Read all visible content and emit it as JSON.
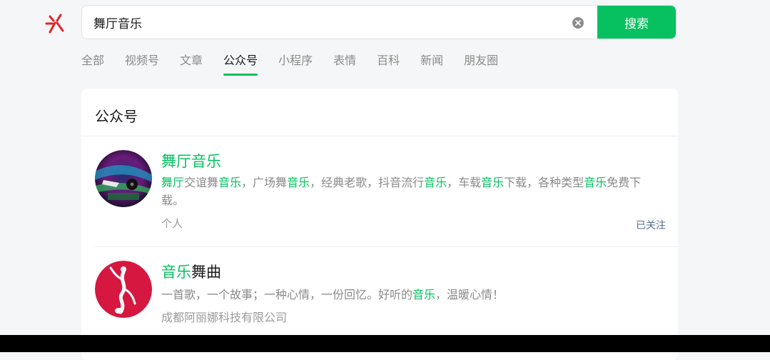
{
  "search": {
    "query": "舞厅音乐",
    "button_label": "搜索"
  },
  "tabs": [
    {
      "label": "全部"
    },
    {
      "label": "视频号"
    },
    {
      "label": "文章"
    },
    {
      "label": "公众号"
    },
    {
      "label": "小程序"
    },
    {
      "label": "表情"
    },
    {
      "label": "百科"
    },
    {
      "label": "新闻"
    },
    {
      "label": "朋友圈"
    }
  ],
  "active_tab": "公众号",
  "section_title": "公众号",
  "accounts": [
    {
      "name": "舞厅音乐",
      "desc_parts": [
        {
          "text": "舞厅",
          "hl": true
        },
        {
          "text": "交谊舞",
          "hl": false
        },
        {
          "text": "音乐",
          "hl": true
        },
        {
          "text": "，广场舞",
          "hl": false
        },
        {
          "text": "音乐",
          "hl": true
        },
        {
          "text": "，经典老歌，抖音流行",
          "hl": false
        },
        {
          "text": "音乐",
          "hl": true
        },
        {
          "text": "，车载",
          "hl": false
        },
        {
          "text": "音乐",
          "hl": true
        },
        {
          "text": "下载，各种类型",
          "hl": false
        },
        {
          "text": "音乐",
          "hl": true
        },
        {
          "text": "免费下载。",
          "hl": false
        }
      ],
      "type": "个人",
      "follow_status": "已关注"
    },
    {
      "name_parts": [
        {
          "text": "音乐",
          "hl": true
        },
        {
          "text": "舞曲",
          "hl": false
        }
      ],
      "desc_parts": [
        {
          "text": "一首歌，一个故事；一种心情，一份回忆。好听的",
          "hl": false
        },
        {
          "text": "音乐",
          "hl": true
        },
        {
          "text": "，温暖心情！",
          "hl": false
        }
      ],
      "company": "成都阿丽娜科技有限公司"
    }
  ],
  "colors": {
    "accent": "#07c160",
    "link": "#576b95",
    "avatar2": "#d6173f"
  }
}
